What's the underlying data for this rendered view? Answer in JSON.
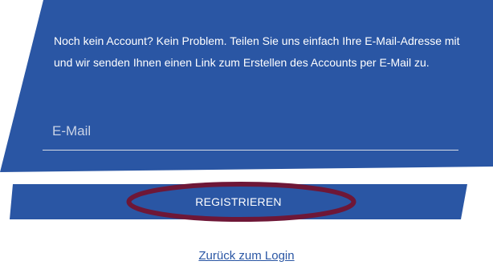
{
  "form": {
    "intro_text": "Noch kein Account? Kein Problem. Teilen Sie uns einfach Ihre E-Mail-Adresse mit und wir senden Ihnen einen Link zum Erstellen des Accounts per E-Mail zu.",
    "email_placeholder": "E-Mail",
    "email_value": "",
    "register_label": "REGISTRIEREN"
  },
  "footer": {
    "back_link_label": "Zurück zum Login"
  },
  "colors": {
    "panel_blue": "#2a56a4",
    "highlight_maroon": "#6e1737",
    "text_white": "#ffffff",
    "link_blue": "#2a56a4"
  }
}
